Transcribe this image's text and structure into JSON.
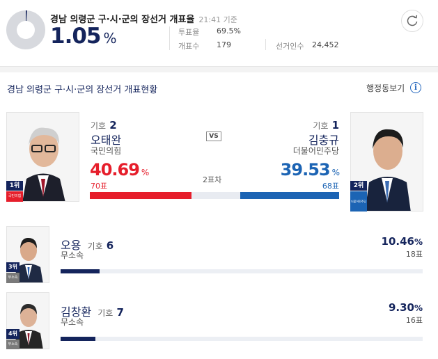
{
  "header": {
    "title": "경남 의령군 구·시·군의 장선거 개표율",
    "time": "21:41 기준",
    "count_rate": "1.05",
    "count_rate_unit": "%",
    "count_rate_fraction": 0.0105,
    "turnout_label": "투표율",
    "turnout_value": "69.5%",
    "ballots_label": "개표수",
    "ballots_value": "179",
    "electorate_label": "선거인수",
    "electorate_value": "24,452"
  },
  "section": {
    "title": "경남 의령군 구·시·군의 장선거 개표현황",
    "link_label": "행정동보기",
    "info_icon": "i"
  },
  "top_race": {
    "vs_label": "VS",
    "diff_label": "2표차",
    "left": {
      "rank": "1위",
      "party_badge": "국민의힘",
      "num_label": "기호",
      "num": "2",
      "name": "오태완",
      "party": "국민의힘",
      "pct": "40.69",
      "pct_sign": "%",
      "votes": "70표",
      "color": "#e61e2b"
    },
    "right": {
      "rank": "2위",
      "party_badge": "더불어민주당",
      "num_label": "기호",
      "num": "1",
      "name": "김충규",
      "party": "더불어민주당",
      "pct": "39.53",
      "pct_sign": "%",
      "votes": "68표",
      "color": "#1c64b4"
    }
  },
  "others": [
    {
      "rank": "3위",
      "party_badge": "무소속",
      "name": "오용",
      "num_label": "기호",
      "num": "6",
      "party": "무소속",
      "pct": "10.46",
      "pct_sign": "%",
      "votes": "18표",
      "bar_fraction": 0.1046
    },
    {
      "rank": "4위",
      "party_badge": "무소속",
      "name": "김창환",
      "num_label": "기호",
      "num": "7",
      "party": "무소속",
      "pct": "9.30",
      "pct_sign": "%",
      "votes": "16표",
      "bar_fraction": 0.093
    }
  ],
  "colors": {
    "navy": "#14245c",
    "ppp_red": "#e61e2b",
    "dem_blue": "#1c64b4",
    "independent_gray": "#7a7a7a"
  }
}
